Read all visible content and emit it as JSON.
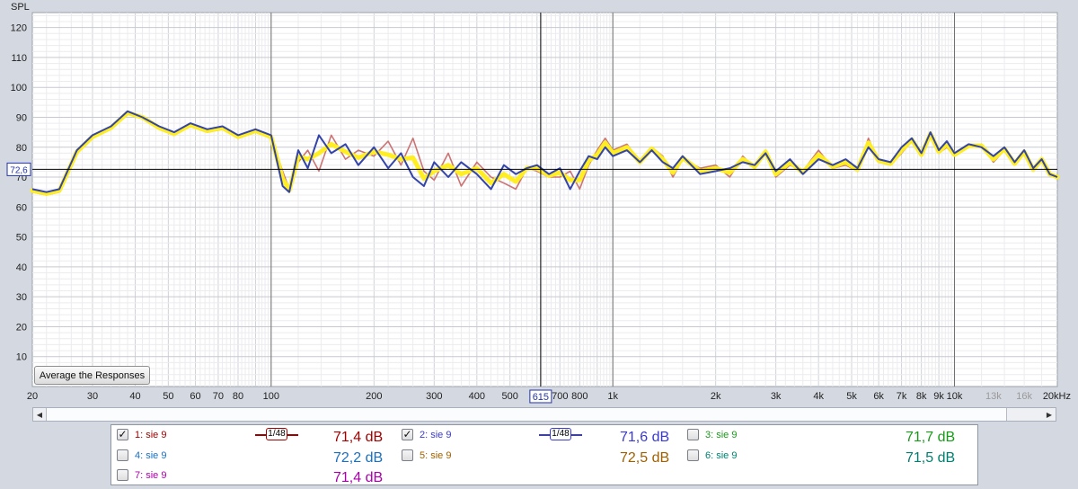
{
  "chart_data": {
    "type": "line",
    "title": "",
    "ylabel": "SPL",
    "xlabel": "",
    "x_scale": "log",
    "xlim": [
      20,
      20000
    ],
    "ylim": [
      0,
      125
    ],
    "grid": true,
    "y_ticks": [
      "10",
      "20",
      "30",
      "40",
      "50",
      "60",
      "70",
      "80",
      "90",
      "100",
      "110",
      "120"
    ],
    "x_ticks": [
      "20",
      "30",
      "40",
      "50",
      "60",
      "70",
      "80",
      "100",
      "200",
      "300",
      "400",
      "500",
      "700",
      "800",
      "1k",
      "2k",
      "3k",
      "4k",
      "5k",
      "6k",
      "7k",
      "8k",
      "9k",
      "10k",
      "13k",
      "16k",
      "20kHz"
    ],
    "cursor": {
      "level_label": "72,6",
      "level": 72.6,
      "freq_label": "615",
      "freq": 615
    },
    "x_points": [
      20,
      22,
      24,
      27,
      30,
      34,
      38,
      42,
      47,
      52,
      58,
      65,
      72,
      80,
      90,
      100,
      108,
      113,
      120,
      128,
      138,
      150,
      165,
      180,
      200,
      220,
      240,
      260,
      280,
      300,
      330,
      360,
      400,
      440,
      480,
      520,
      560,
      600,
      650,
      700,
      750,
      800,
      850,
      900,
      950,
      1000,
      1100,
      1200,
      1300,
      1400,
      1500,
      1600,
      1800,
      2000,
      2200,
      2400,
      2600,
      2800,
      3000,
      3300,
      3600,
      4000,
      4400,
      4800,
      5200,
      5600,
      6000,
      6500,
      7000,
      7500,
      8000,
      8500,
      9000,
      9500,
      10000,
      11000,
      12000,
      13000,
      14000,
      15000,
      16000,
      17000,
      18000,
      19000,
      20000
    ],
    "series": [
      {
        "name": "1: sie 9",
        "color": "#cc7373",
        "values": [
          65,
          64,
          65,
          78,
          83,
          86,
          91,
          90,
          86,
          84,
          87,
          85,
          86,
          83,
          85,
          83,
          72,
          66,
          75,
          79,
          72,
          84,
          76,
          79,
          77,
          82,
          74,
          83,
          72,
          69,
          78,
          67,
          75,
          70,
          68,
          66,
          73,
          72,
          70,
          70,
          72,
          66,
          74,
          79,
          83,
          79,
          81,
          75,
          80,
          77,
          70,
          76,
          73,
          74,
          70,
          77,
          73,
          79,
          70,
          74,
          72,
          79,
          73,
          74,
          72,
          83,
          75,
          74,
          78,
          82,
          77,
          84,
          78,
          80,
          77,
          80,
          81,
          75,
          79,
          74,
          78,
          72,
          76,
          71,
          70
        ]
      },
      {
        "name": "2: sie 9",
        "color": "#3344aa",
        "values": [
          66,
          65,
          66,
          79,
          84,
          87,
          92,
          90,
          87,
          85,
          88,
          86,
          87,
          84,
          86,
          84,
          67,
          65,
          79,
          73,
          84,
          78,
          81,
          74,
          80,
          73,
          78,
          70,
          67,
          75,
          70,
          75,
          71,
          66,
          74,
          71,
          73,
          74,
          71,
          73,
          66,
          72,
          77,
          76,
          80,
          77,
          79,
          75,
          79,
          75,
          73,
          77,
          71,
          72,
          73,
          75,
          74,
          78,
          72,
          76,
          71,
          76,
          74,
          76,
          73,
          80,
          76,
          75,
          80,
          83,
          78,
          85,
          79,
          82,
          78,
          81,
          80,
          77,
          80,
          75,
          79,
          73,
          76,
          71,
          70
        ]
      },
      {
        "name": "average",
        "color": "#ffee22",
        "values": [
          65.5,
          64.5,
          65.5,
          78.5,
          83.5,
          86.5,
          91.5,
          90,
          86.5,
          84.5,
          87.5,
          85.5,
          86.5,
          83.5,
          85.5,
          83.5,
          69.5,
          65.5,
          77,
          76,
          78,
          81,
          78.5,
          76.5,
          78.5,
          77.5,
          76,
          76.5,
          69.5,
          72,
          74,
          71,
          73,
          68,
          71,
          68.5,
          73,
          73,
          70.5,
          71.5,
          69,
          69,
          75.5,
          77.5,
          81.5,
          78,
          80,
          75,
          79.5,
          76,
          71.5,
          76.5,
          72,
          73,
          71.5,
          76,
          73.5,
          78.5,
          71,
          75,
          71.5,
          77.5,
          73.5,
          75,
          72.5,
          81.5,
          75.5,
          74.5,
          79,
          82.5,
          77.5,
          84.5,
          78.5,
          81,
          77.5,
          80.5,
          80.5,
          76,
          79.5,
          74.5,
          78.5,
          72.5,
          76,
          71,
          70
        ]
      }
    ]
  },
  "button": {
    "label": "Average the Responses"
  },
  "scroll": {
    "left": "◀",
    "right": "▶"
  },
  "legend": {
    "items": [
      {
        "label": "1: sie 9",
        "db": "71,4 dB",
        "checked": "✓",
        "color": "#a00000",
        "smoothing": "1/48"
      },
      {
        "label": "2: sie 9",
        "db": "71,6 dB",
        "checked": "✓",
        "color": "#3a3acc",
        "smoothing": "1/48"
      },
      {
        "label": "3: sie 9",
        "db": "71,7 dB",
        "checked": "",
        "color": "#1a9a1a"
      },
      {
        "label": "4: sie 9",
        "db": "72,2 dB",
        "checked": "",
        "color": "#1a6fc0"
      },
      {
        "label": "5: sie 9",
        "db": "72,5 dB",
        "checked": "",
        "color": "#a06000"
      },
      {
        "label": "6: sie 9",
        "db": "71,5 dB",
        "checked": "",
        "color": "#008070"
      },
      {
        "label": "7: sie 9",
        "db": "71,4 dB",
        "checked": "",
        "color": "#aa00aa"
      }
    ]
  }
}
